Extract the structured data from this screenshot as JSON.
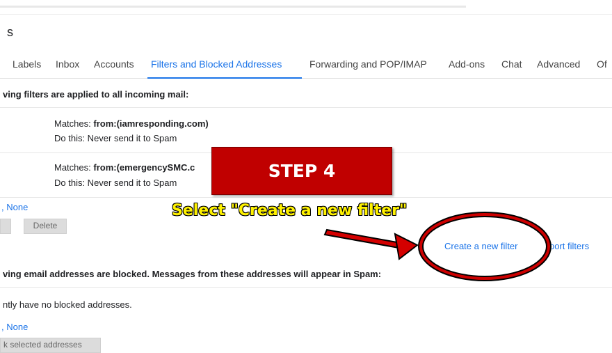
{
  "header": {
    "title": "s"
  },
  "tabs": [
    {
      "label": "Labels"
    },
    {
      "label": "Inbox"
    },
    {
      "label": "Accounts"
    },
    {
      "label": "Filters and Blocked Addresses"
    },
    {
      "label": "Forwarding and POP/IMAP"
    },
    {
      "label": "Add-ons"
    },
    {
      "label": "Chat"
    },
    {
      "label": "Advanced"
    },
    {
      "label": "Of"
    }
  ],
  "filters_section": {
    "heading": "ving filters are applied to all incoming mail:",
    "filters": [
      {
        "matches_label": "Matches: ",
        "matches_value": "from:(iamresponding.com)",
        "action": "Do this: Never send it to Spam"
      },
      {
        "matches_label": "Matches: ",
        "matches_value": "from:(emergencySMC.c",
        "action": "Do this: Never send it to Spam"
      }
    ],
    "select_none": ", None",
    "delete_label": "Delete",
    "create_filter_label": "Create a new filter",
    "import_filters_label": "port filters"
  },
  "blocked_section": {
    "heading": "ving email addresses are blocked. Messages from these addresses will appear in Spam:",
    "empty_message": "ntly have no blocked addresses.",
    "select_none": ", None",
    "unblock_label": "k selected addresses"
  },
  "overlay": {
    "step_label": "STEP 4",
    "instruction": "Select \"Create a new filter\"",
    "colors": {
      "box": "#c00000",
      "text": "#fff200",
      "ring": "#cc0000"
    }
  }
}
